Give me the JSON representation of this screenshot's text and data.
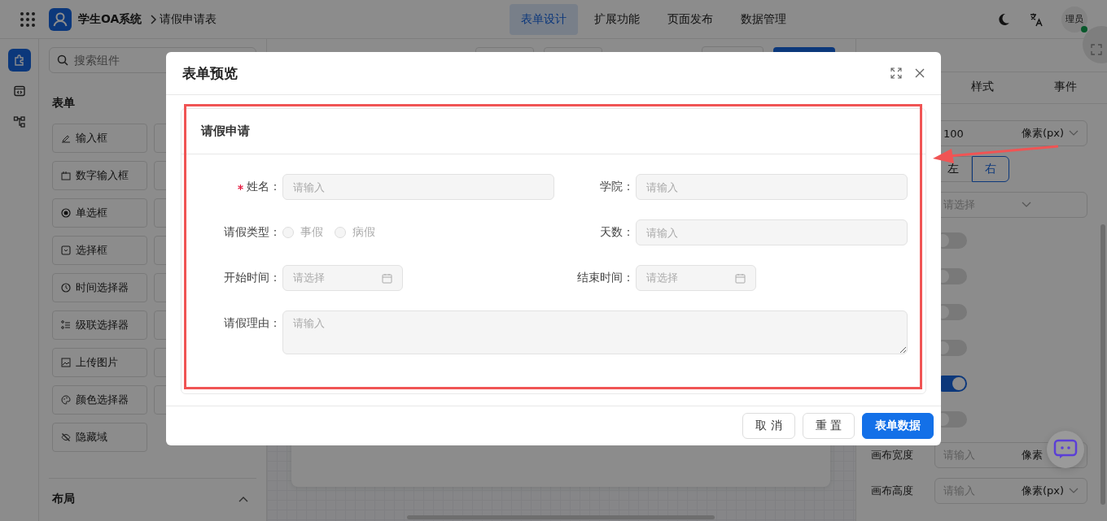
{
  "header": {
    "app_name": "学生OA系统",
    "breadcrumb": "请假申请表",
    "nav": [
      {
        "label": "表单设计",
        "selected": true
      },
      {
        "label": "扩展功能",
        "selected": false
      },
      {
        "label": "页面发布",
        "selected": false
      },
      {
        "label": "数据管理",
        "selected": false
      }
    ],
    "avatar": {
      "label": "理员",
      "online": true
    }
  },
  "rail": [
    {
      "selected": true
    },
    {
      "selected": false
    },
    {
      "selected": false
    }
  ],
  "left_panel": {
    "search": {
      "placeholder": "搜索组件"
    },
    "section": "表单",
    "components": [
      {
        "label": "输入框"
      },
      {
        "label": "数字输入框"
      },
      {
        "label": "单选框"
      },
      {
        "label": "选择框"
      },
      {
        "label": "时间选择器"
      },
      {
        "label": "级联选择器"
      },
      {
        "label": "上传图片"
      },
      {
        "label": "颜色选择器"
      },
      {
        "label": "隐藏域"
      }
    ],
    "section_2": "布局"
  },
  "right_panel": {
    "tabs": [
      {
        "label": "样式",
        "selected": false
      },
      {
        "label": "事件",
        "selected": false
      }
    ],
    "rows": [
      {
        "kind": "unit-input",
        "value": "100",
        "unit": "像素(px)"
      },
      {
        "kind": "segmented",
        "options": [
          {
            "label": "左",
            "selected": false
          },
          {
            "label": "右",
            "selected": true
          }
        ]
      },
      {
        "kind": "select",
        "placeholder": "请选择"
      },
      {
        "kind": "switch",
        "on": false
      },
      {
        "kind": "switch",
        "on": false
      },
      {
        "kind": "switch",
        "on": false
      },
      {
        "kind": "switch",
        "on": false
      },
      {
        "kind": "switch",
        "on": true
      },
      {
        "kind": "switch",
        "on": false
      },
      {
        "kind": "unit-input",
        "label": "画布宽度",
        "placeholder": "请输入",
        "unit": "像素"
      },
      {
        "kind": "unit-input",
        "label": "画布高度",
        "placeholder": "请输入",
        "unit": "像素(px)"
      }
    ]
  },
  "dialog": {
    "title": "表单预览",
    "form_title": "请假申请",
    "fields": [
      {
        "label": "姓名：",
        "required": true,
        "kind": "text",
        "placeholder": "请输入"
      },
      {
        "label": "学院：",
        "required": false,
        "kind": "text",
        "placeholder": "请输入"
      },
      {
        "label": "请假类型：",
        "required": false,
        "kind": "radio",
        "options": [
          {
            "label": "事假",
            "selected": false
          },
          {
            "label": "病假",
            "selected": false
          }
        ]
      },
      {
        "label": "天数：",
        "required": false,
        "kind": "text",
        "placeholder": "请输入"
      },
      {
        "label": "开始时间：",
        "required": false,
        "kind": "date",
        "placeholder": "请选择"
      },
      {
        "label": "结束时间：",
        "required": false,
        "kind": "date",
        "placeholder": "请选择"
      },
      {
        "label": "请假理由：",
        "required": false,
        "kind": "textarea",
        "placeholder": "请输入"
      }
    ],
    "buttons": [
      {
        "label": "取 消",
        "primary": false
      },
      {
        "label": "重 置",
        "primary": false
      },
      {
        "label": "表单数据",
        "primary": true
      }
    ]
  }
}
